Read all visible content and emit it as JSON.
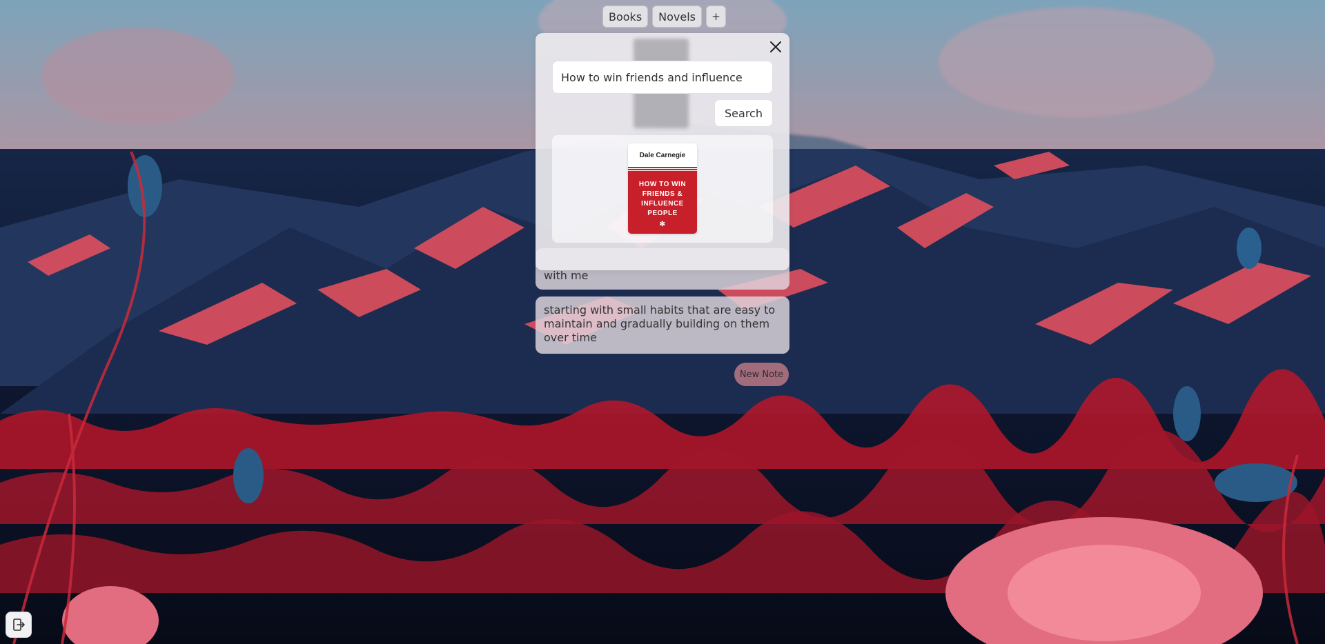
{
  "tabs": [
    {
      "label": "Books"
    },
    {
      "label": "Novels"
    },
    {
      "label": "+"
    }
  ],
  "search": {
    "value": "How to win friends and influence",
    "button_label": "Search"
  },
  "result": {
    "author": "Dale Carnegie",
    "title_lines": [
      "HOW TO WIN",
      "FRIENDS &",
      "INFLUENCE",
      "PEOPLE"
    ],
    "emblem": "✻"
  },
  "notes": [
    {
      "text": "with me"
    },
    {
      "text": "starting with small habits that are easy to maintain and gradually building on them over time"
    }
  ],
  "new_note_label": "New Note",
  "icons": {
    "close": "close-icon",
    "logout": "logout-icon"
  },
  "colors": {
    "cover_red": "#c8202a",
    "note_bg": "#e1d7de",
    "new_note_bg": "#d2828c"
  }
}
